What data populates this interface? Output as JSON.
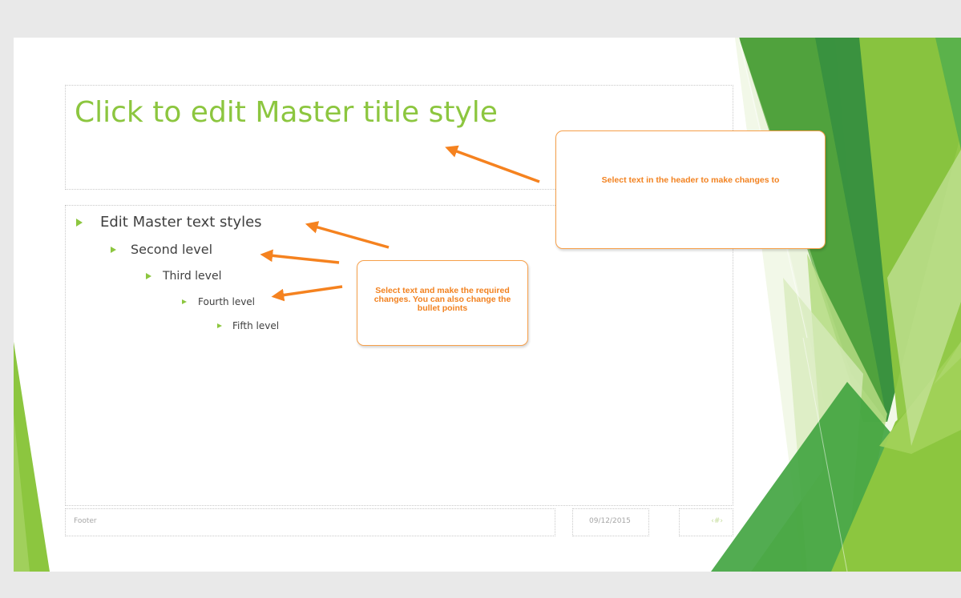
{
  "colors": {
    "background": "#e9e9e9",
    "slide": "#ffffff",
    "title_accent": "#8cc63f",
    "callout_text": "#f28220",
    "callout_border": "#f7a04a",
    "arrow": "#f5821f"
  },
  "slide": {
    "title": "Click to edit Master title style",
    "body_levels": [
      "Edit Master text styles",
      "Second level",
      "Third level",
      "Fourth level",
      "Fifth level"
    ],
    "footer": "Footer",
    "date": "09/12/2015",
    "slide_number": "‹#›"
  },
  "callouts": {
    "header": "Select text in the header to make changes to",
    "body": "Select text and make the required changes. You can also change the bullet points"
  },
  "icons": [
    "bullet-triangle-icon",
    "arrow-icon"
  ]
}
